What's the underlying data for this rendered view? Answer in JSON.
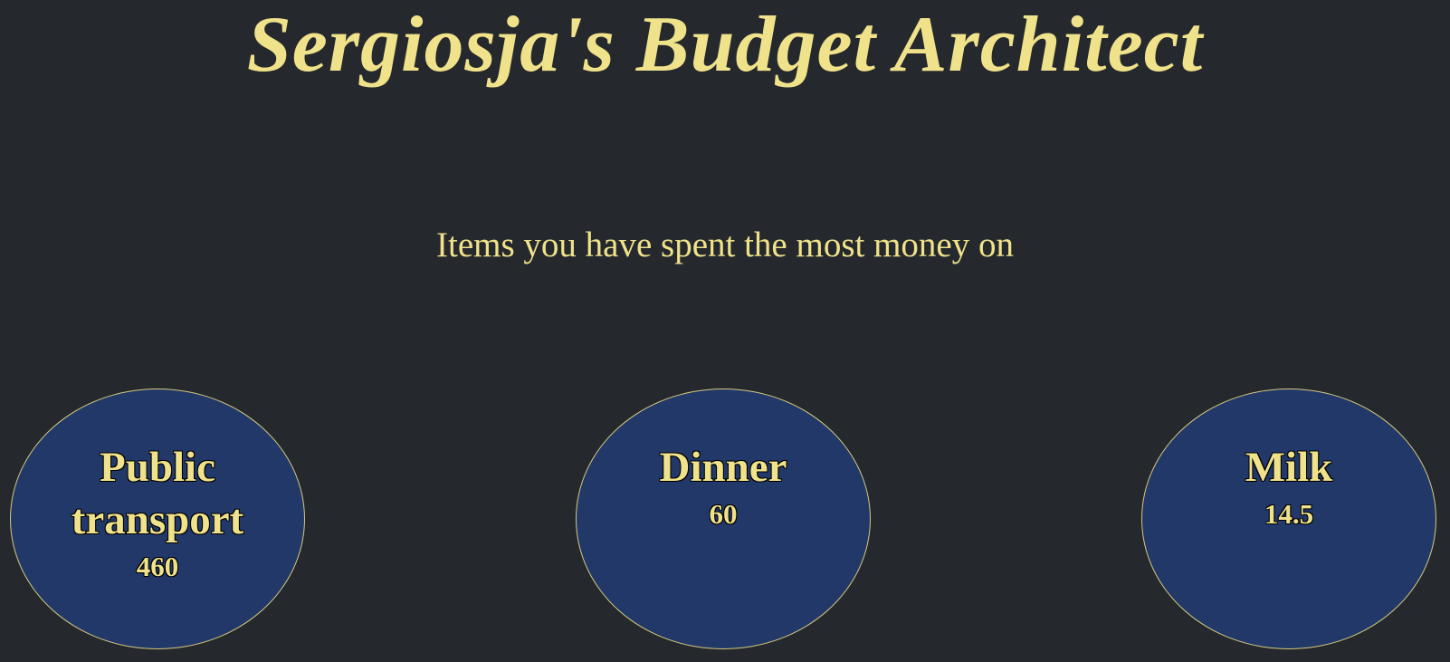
{
  "header": {
    "title": "Sergiosja's Budget Architect"
  },
  "section": {
    "heading": "Items you have spent the most money on"
  },
  "top_items": [
    {
      "name": "Public transport",
      "amount": "460"
    },
    {
      "name": "Dinner",
      "amount": "60"
    },
    {
      "name": "Milk",
      "amount": "14.5"
    }
  ],
  "colors": {
    "background": "#25292d",
    "text": "#f0e28a",
    "bubble_fill": "#213869",
    "bubble_border": "#d6c97e"
  }
}
